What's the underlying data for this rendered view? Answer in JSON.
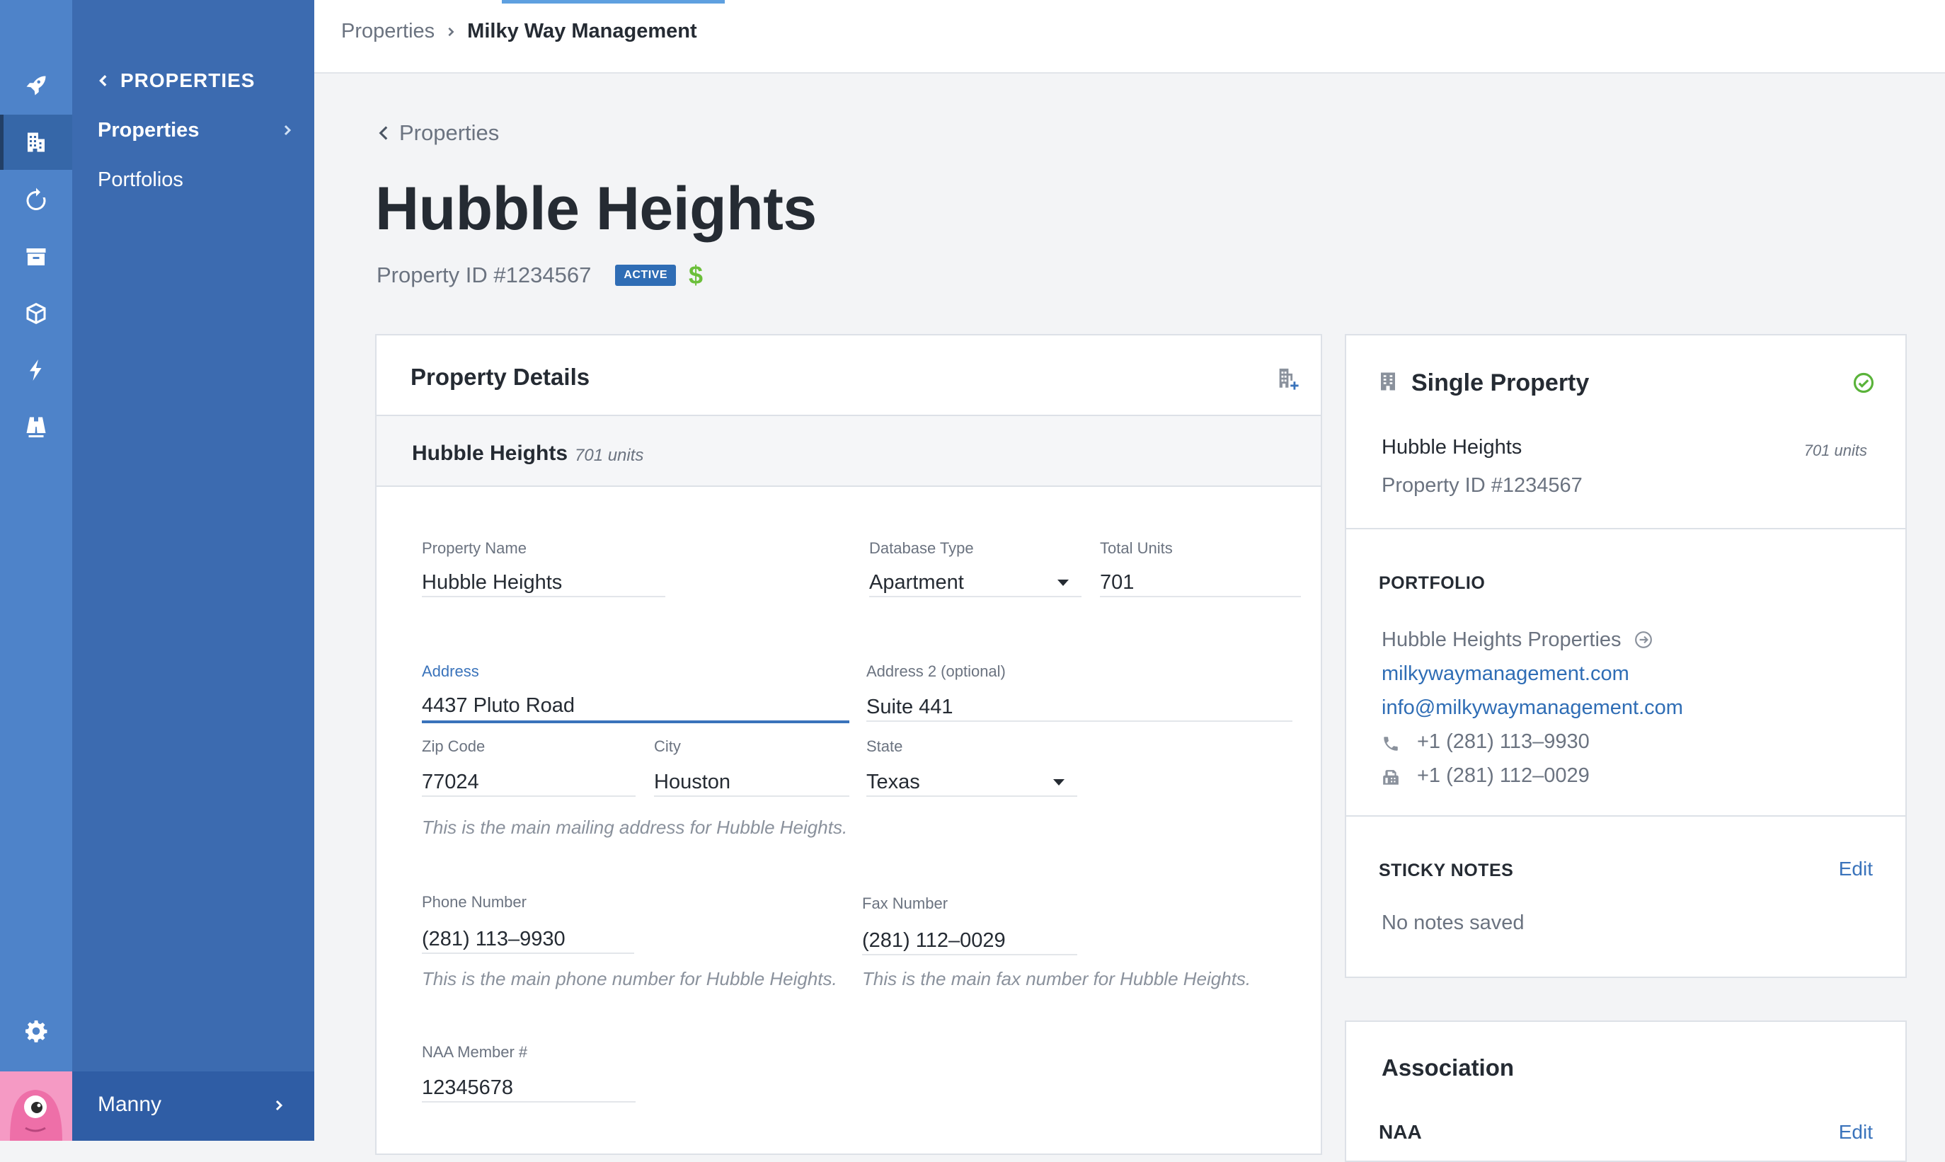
{
  "nav": {
    "rail_items": [
      {
        "icon": "rocket-icon"
      },
      {
        "icon": "building-icon",
        "active": true
      },
      {
        "icon": "refresh-icon"
      },
      {
        "icon": "archive-box-icon"
      },
      {
        "icon": "cube-icon"
      },
      {
        "icon": "lightning-icon"
      },
      {
        "icon": "binoculars-icon"
      }
    ],
    "settings_icon": "gear-icon",
    "section_title": "PROPERTIES",
    "items": [
      {
        "label": "Properties",
        "active": true
      },
      {
        "label": "Portfolios"
      }
    ],
    "user": {
      "name": "Manny"
    }
  },
  "topbar": {
    "breadcrumb": [
      "Properties",
      "Milky Way Management"
    ]
  },
  "page": {
    "back_label": "Properties",
    "title": "Hubble Heights",
    "property_id": "Property ID #1234567",
    "status": "ACTIVE",
    "currency_symbol": "$"
  },
  "details": {
    "title": "Property Details",
    "subhead_name": "Hubble Heights",
    "subhead_units": "701 units",
    "fields": {
      "property_name": {
        "label": "Property Name",
        "value": "Hubble Heights"
      },
      "database_type": {
        "label": "Database Type",
        "value": "Apartment"
      },
      "total_units": {
        "label": "Total Units",
        "value": "701"
      },
      "address": {
        "label": "Address",
        "value": "4437 Pluto Road"
      },
      "address2": {
        "label": "Address 2 (optional)",
        "value": "Suite 441"
      },
      "zip": {
        "label": "Zip Code",
        "value": "77024"
      },
      "city": {
        "label": "City",
        "value": "Houston"
      },
      "state": {
        "label": "State",
        "value": "Texas"
      },
      "phone": {
        "label": "Phone Number",
        "value": "(281) 113–9930"
      },
      "fax": {
        "label": "Fax Number",
        "value": "(281) 112–0029"
      },
      "naa": {
        "label": "NAA Member #",
        "value": "12345678"
      }
    },
    "hints": {
      "address": "This is the main mailing address for Hubble Heights.",
      "phone": "This is the main phone number for Hubble Heights.",
      "fax": "This is the main fax number for Hubble Heights."
    }
  },
  "single_property": {
    "title": "Single Property",
    "name": "Hubble Heights",
    "units": "701 units",
    "property_id": "Property ID #1234567"
  },
  "portfolio": {
    "label": "PORTFOLIO",
    "name": "Hubble Heights Properties",
    "website": "milkywaymanagement.com",
    "email": "info@milkywaymanagement.com",
    "phone": "+1 (281) 113–9930",
    "fax": "+1 (281) 112–0029"
  },
  "sticky_notes": {
    "label": "STICKY NOTES",
    "edit_label": "Edit",
    "empty_text": "No notes saved"
  },
  "association": {
    "title": "Association",
    "name": "NAA",
    "edit_label": "Edit"
  },
  "colors": {
    "rail": "#4e83c9",
    "subnav": "#3c6bb0",
    "accent": "#3a73bb",
    "success": "#5ab33a",
    "money": "#6bbf3a"
  }
}
